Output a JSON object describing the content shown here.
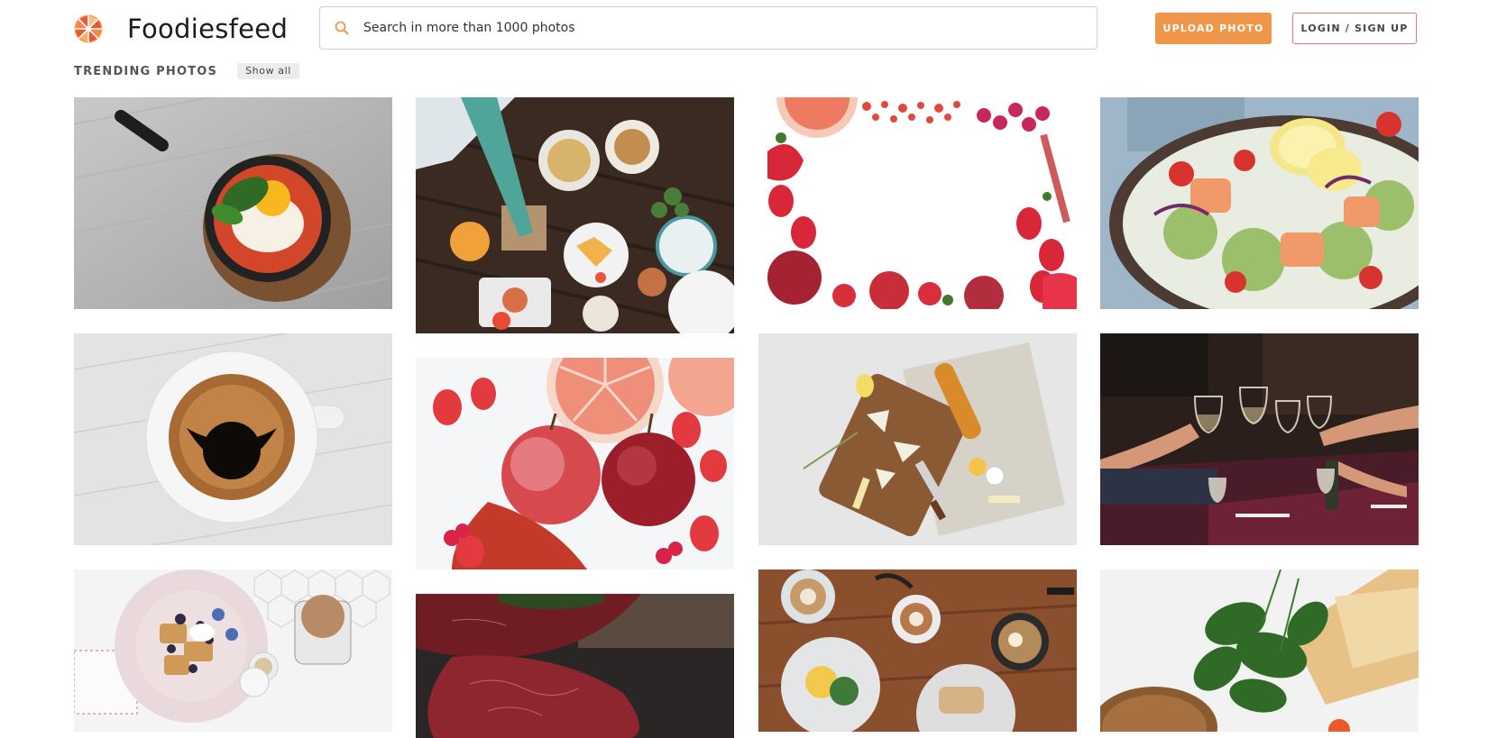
{
  "header": {
    "brand": "Foodiesfeed",
    "brand_colors": [
      "#f0964a",
      "#e8573f"
    ],
    "search": {
      "placeholder": "Search in more than 1000 photos",
      "value": ""
    },
    "upload_label": "UPLOAD PHOTO",
    "login_label": "LOGIN / SIGN UP"
  },
  "section": {
    "title": "TRENDING PHOTOS",
    "show_all": "Show all"
  },
  "photos": [
    {
      "subject": "shakshuka-skillet-with-egg-and-spinach"
    },
    {
      "subject": "table-spread-from-above"
    },
    {
      "subject": "fruit-frame-on-white"
    },
    {
      "subject": "salmon-salad-with-lemon"
    },
    {
      "subject": "espresso-cup"
    },
    {
      "subject": "apples-grapefruit-strawberries"
    },
    {
      "subject": "cheese-board-with-baguette"
    },
    {
      "subject": "wine-toast-at-restaurant"
    },
    {
      "subject": "waffles-with-berries"
    },
    {
      "subject": "raw-beef-steaks"
    },
    {
      "subject": "brunch-table-with-coffee"
    },
    {
      "subject": "spinach-and-cheese"
    }
  ]
}
